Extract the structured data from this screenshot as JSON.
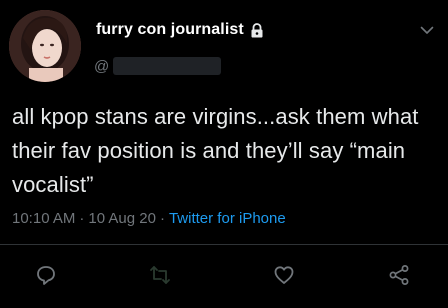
{
  "author": {
    "display_name": "furry con journalist",
    "handle_prefix": "@",
    "protected": true
  },
  "tweet": {
    "text": "all kpop stans are virgins...ask them what their fav position is and they’ll say “main vocalist”",
    "time": "10:10 AM",
    "separator": "·",
    "date": "10 Aug 20",
    "source": "Twitter for iPhone"
  },
  "icons": {
    "lock": "lock-icon",
    "caret": "chevron-down-icon",
    "reply": "reply-icon",
    "retweet": "retweet-icon",
    "like": "heart-icon",
    "share": "share-icon"
  },
  "colors": {
    "background": "#000000",
    "text": "#e7e9ea",
    "muted": "#71767b",
    "link": "#1d9bf0"
  }
}
